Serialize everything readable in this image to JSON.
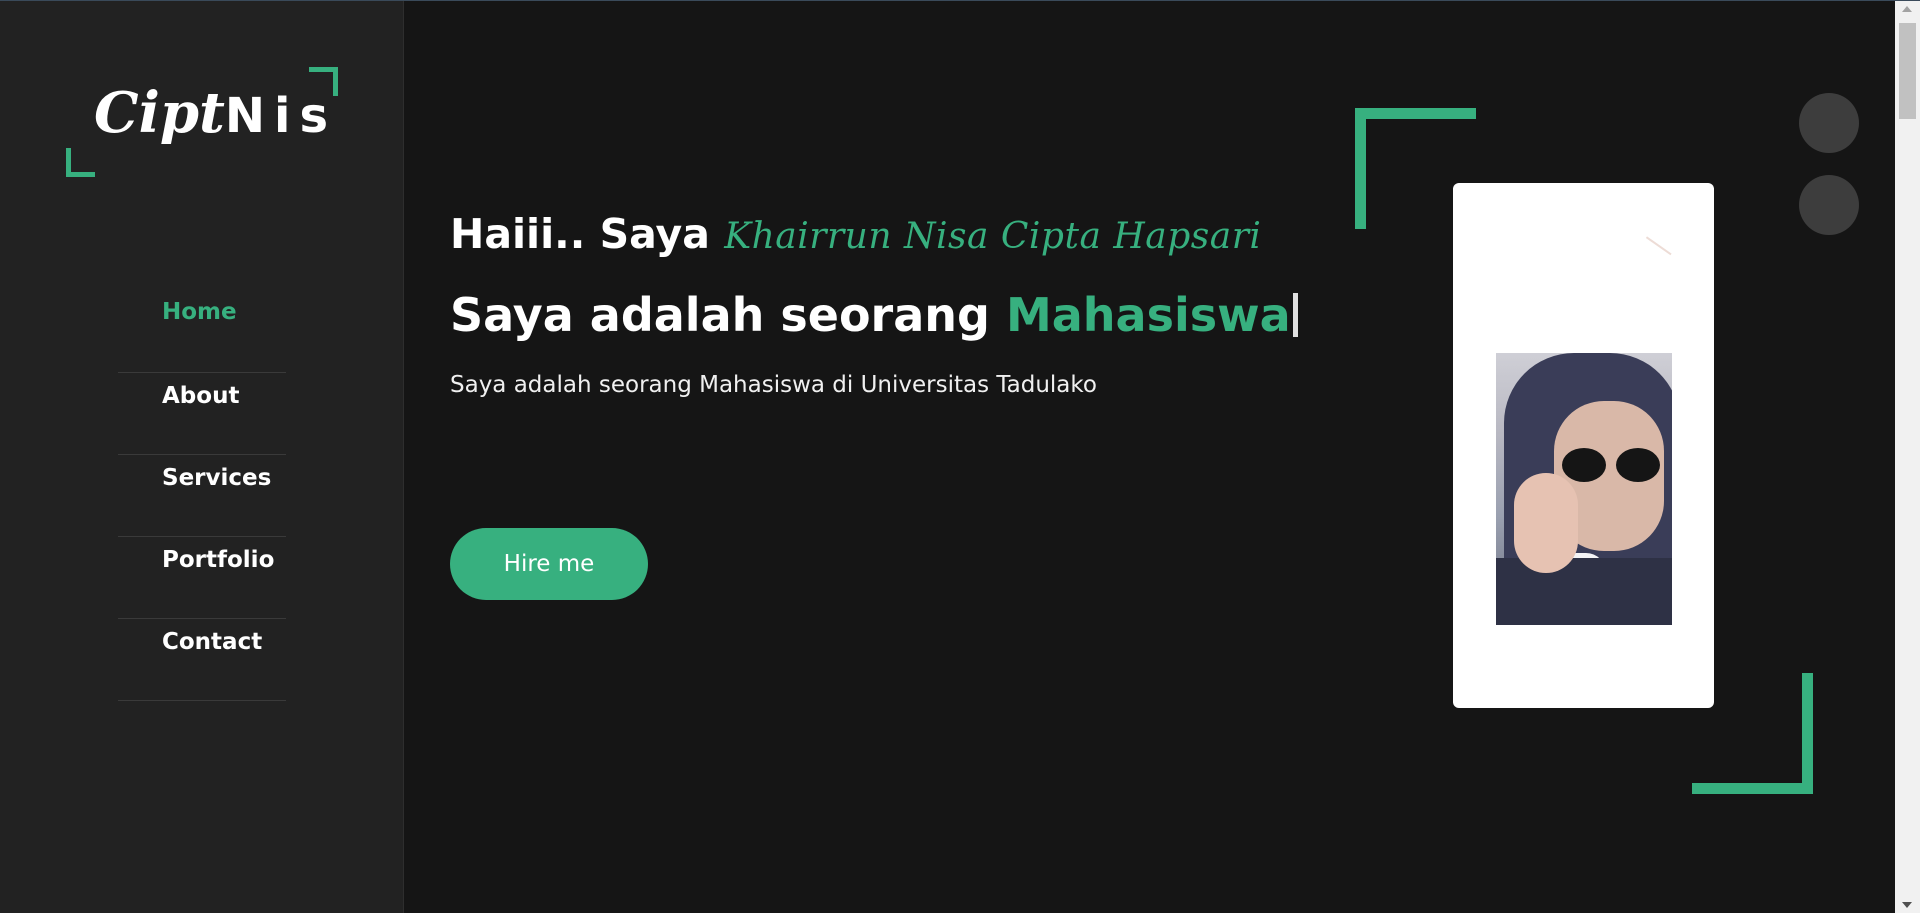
{
  "logo": {
    "script_part": "Cipt",
    "bold_part": "Nis"
  },
  "nav": {
    "items": [
      {
        "label": "Home",
        "active": true
      },
      {
        "label": "About",
        "active": false
      },
      {
        "label": "Services",
        "active": false
      },
      {
        "label": "Portfolio",
        "active": false
      },
      {
        "label": "Contact",
        "active": false
      }
    ]
  },
  "hero": {
    "greeting": "Haiii.. Saya",
    "name": "Khairrun Nisa Cipta Hapsari",
    "role_prefix": "Saya adalah seorang",
    "role_accent": "Mahasiswa",
    "description": "Saya adalah seorang Mahasiswa di Universitas Tadulako",
    "hire_label": "Hire me"
  },
  "colors": {
    "accent": "#37b07f",
    "background": "#151515",
    "sidebar": "#222222"
  },
  "icons": {
    "toggle_top": "circle-button",
    "toggle_bottom": "circle-button"
  }
}
